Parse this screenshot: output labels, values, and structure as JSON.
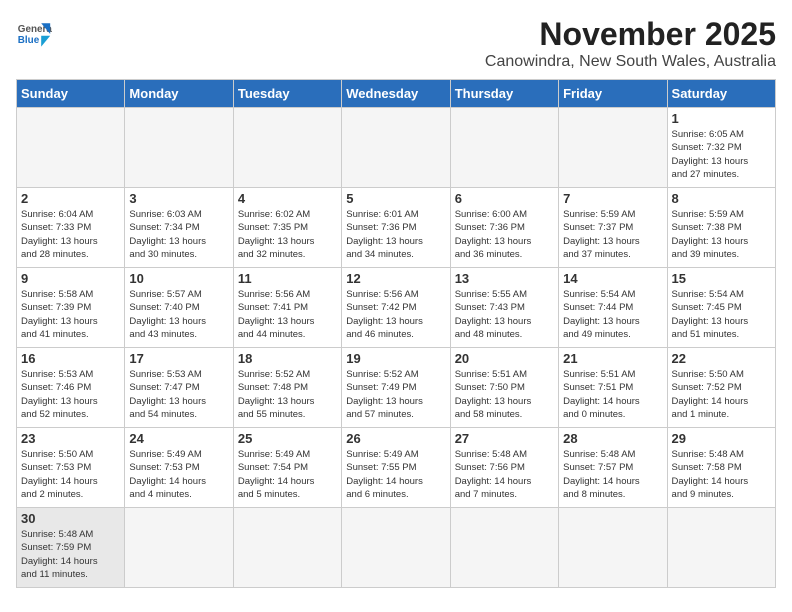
{
  "header": {
    "logo_general": "General",
    "logo_blue": "Blue",
    "month_title": "November 2025",
    "location": "Canowindra, New South Wales, Australia"
  },
  "days_of_week": [
    "Sunday",
    "Monday",
    "Tuesday",
    "Wednesday",
    "Thursday",
    "Friday",
    "Saturday"
  ],
  "weeks": [
    [
      {
        "day": "",
        "info": ""
      },
      {
        "day": "",
        "info": ""
      },
      {
        "day": "",
        "info": ""
      },
      {
        "day": "",
        "info": ""
      },
      {
        "day": "",
        "info": ""
      },
      {
        "day": "",
        "info": ""
      },
      {
        "day": "1",
        "info": "Sunrise: 6:05 AM\nSunset: 7:32 PM\nDaylight: 13 hours\nand 27 minutes."
      }
    ],
    [
      {
        "day": "2",
        "info": "Sunrise: 6:04 AM\nSunset: 7:33 PM\nDaylight: 13 hours\nand 28 minutes."
      },
      {
        "day": "3",
        "info": "Sunrise: 6:03 AM\nSunset: 7:34 PM\nDaylight: 13 hours\nand 30 minutes."
      },
      {
        "day": "4",
        "info": "Sunrise: 6:02 AM\nSunset: 7:35 PM\nDaylight: 13 hours\nand 32 minutes."
      },
      {
        "day": "5",
        "info": "Sunrise: 6:01 AM\nSunset: 7:36 PM\nDaylight: 13 hours\nand 34 minutes."
      },
      {
        "day": "6",
        "info": "Sunrise: 6:00 AM\nSunset: 7:36 PM\nDaylight: 13 hours\nand 36 minutes."
      },
      {
        "day": "7",
        "info": "Sunrise: 5:59 AM\nSunset: 7:37 PM\nDaylight: 13 hours\nand 37 minutes."
      },
      {
        "day": "8",
        "info": "Sunrise: 5:59 AM\nSunset: 7:38 PM\nDaylight: 13 hours\nand 39 minutes."
      }
    ],
    [
      {
        "day": "9",
        "info": "Sunrise: 5:58 AM\nSunset: 7:39 PM\nDaylight: 13 hours\nand 41 minutes."
      },
      {
        "day": "10",
        "info": "Sunrise: 5:57 AM\nSunset: 7:40 PM\nDaylight: 13 hours\nand 43 minutes."
      },
      {
        "day": "11",
        "info": "Sunrise: 5:56 AM\nSunset: 7:41 PM\nDaylight: 13 hours\nand 44 minutes."
      },
      {
        "day": "12",
        "info": "Sunrise: 5:56 AM\nSunset: 7:42 PM\nDaylight: 13 hours\nand 46 minutes."
      },
      {
        "day": "13",
        "info": "Sunrise: 5:55 AM\nSunset: 7:43 PM\nDaylight: 13 hours\nand 48 minutes."
      },
      {
        "day": "14",
        "info": "Sunrise: 5:54 AM\nSunset: 7:44 PM\nDaylight: 13 hours\nand 49 minutes."
      },
      {
        "day": "15",
        "info": "Sunrise: 5:54 AM\nSunset: 7:45 PM\nDaylight: 13 hours\nand 51 minutes."
      }
    ],
    [
      {
        "day": "16",
        "info": "Sunrise: 5:53 AM\nSunset: 7:46 PM\nDaylight: 13 hours\nand 52 minutes."
      },
      {
        "day": "17",
        "info": "Sunrise: 5:53 AM\nSunset: 7:47 PM\nDaylight: 13 hours\nand 54 minutes."
      },
      {
        "day": "18",
        "info": "Sunrise: 5:52 AM\nSunset: 7:48 PM\nDaylight: 13 hours\nand 55 minutes."
      },
      {
        "day": "19",
        "info": "Sunrise: 5:52 AM\nSunset: 7:49 PM\nDaylight: 13 hours\nand 57 minutes."
      },
      {
        "day": "20",
        "info": "Sunrise: 5:51 AM\nSunset: 7:50 PM\nDaylight: 13 hours\nand 58 minutes."
      },
      {
        "day": "21",
        "info": "Sunrise: 5:51 AM\nSunset: 7:51 PM\nDaylight: 14 hours\nand 0 minutes."
      },
      {
        "day": "22",
        "info": "Sunrise: 5:50 AM\nSunset: 7:52 PM\nDaylight: 14 hours\nand 1 minute."
      }
    ],
    [
      {
        "day": "23",
        "info": "Sunrise: 5:50 AM\nSunset: 7:53 PM\nDaylight: 14 hours\nand 2 minutes."
      },
      {
        "day": "24",
        "info": "Sunrise: 5:49 AM\nSunset: 7:53 PM\nDaylight: 14 hours\nand 4 minutes."
      },
      {
        "day": "25",
        "info": "Sunrise: 5:49 AM\nSunset: 7:54 PM\nDaylight: 14 hours\nand 5 minutes."
      },
      {
        "day": "26",
        "info": "Sunrise: 5:49 AM\nSunset: 7:55 PM\nDaylight: 14 hours\nand 6 minutes."
      },
      {
        "day": "27",
        "info": "Sunrise: 5:48 AM\nSunset: 7:56 PM\nDaylight: 14 hours\nand 7 minutes."
      },
      {
        "day": "28",
        "info": "Sunrise: 5:48 AM\nSunset: 7:57 PM\nDaylight: 14 hours\nand 8 minutes."
      },
      {
        "day": "29",
        "info": "Sunrise: 5:48 AM\nSunset: 7:58 PM\nDaylight: 14 hours\nand 9 minutes."
      }
    ],
    [
      {
        "day": "30",
        "info": "Sunrise: 5:48 AM\nSunset: 7:59 PM\nDaylight: 14 hours\nand 11 minutes."
      },
      {
        "day": "",
        "info": ""
      },
      {
        "day": "",
        "info": ""
      },
      {
        "day": "",
        "info": ""
      },
      {
        "day": "",
        "info": ""
      },
      {
        "day": "",
        "info": ""
      },
      {
        "day": "",
        "info": ""
      }
    ]
  ]
}
